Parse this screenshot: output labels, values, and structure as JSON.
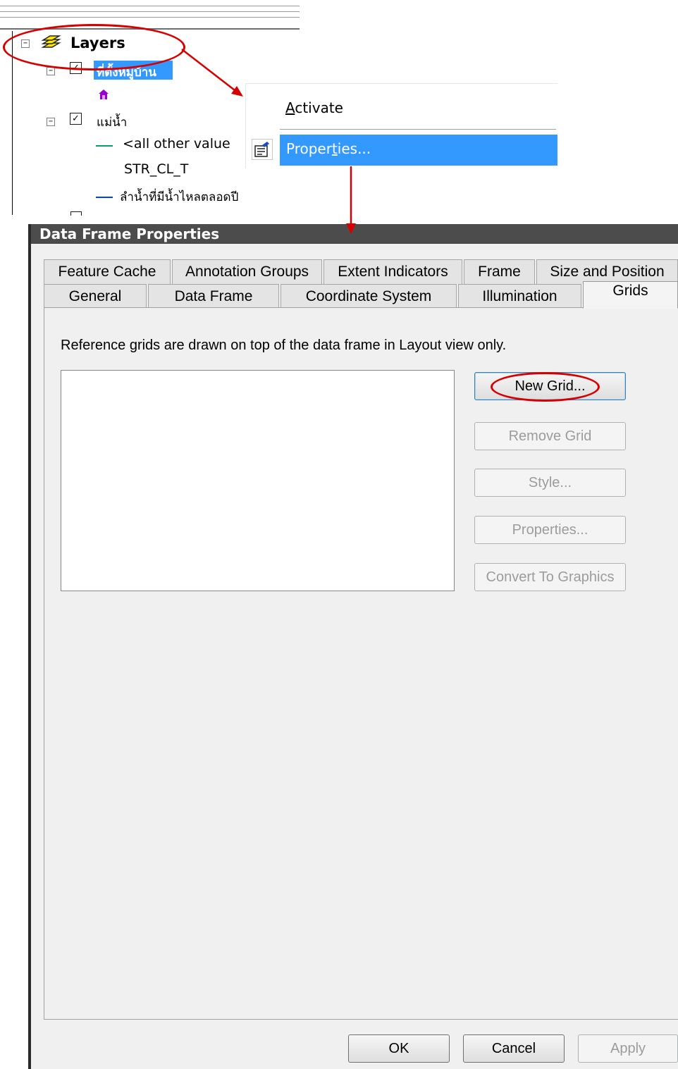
{
  "toc": {
    "root_label": "Layers",
    "layers": [
      {
        "label": "ที่ตั้งหมู่บ้าน",
        "checked": true,
        "selected": true,
        "symbol_color": "#9900cc"
      },
      {
        "label": "แม่น้ำ",
        "checked": true,
        "legend": [
          {
            "label": "<all other value",
            "color": "#00a06e"
          },
          {
            "label": "STR_CL_T"
          },
          {
            "label": "ลำน้ำที่มีน้ำไหลตลอดปี",
            "color": "#0040ff"
          }
        ]
      }
    ]
  },
  "context_menu": {
    "items": [
      {
        "label": "Activate",
        "mnemonic": "A",
        "rest": "ctivate"
      },
      {
        "label": "Properties...",
        "highlighted": true,
        "before": "Proper",
        "mnemonic": "t",
        "after": "ies...",
        "icon": "properties-icon"
      }
    ]
  },
  "dialog": {
    "title": "Data Frame Properties",
    "tabs_row1": [
      "Feature Cache",
      "Annotation Groups",
      "Extent Indicators",
      "Frame",
      "Size and Position"
    ],
    "tabs_row2": [
      "General",
      "Data Frame",
      "Coordinate System",
      "Illumination",
      "Grids"
    ],
    "active_tab": "Grids",
    "grids_page": {
      "description": "Reference grids are drawn on top of the data frame in Layout view only.",
      "buttons": {
        "new_grid": "New Grid...",
        "remove_grid": "Remove Grid",
        "style": "Style...",
        "properties": "Properties...",
        "convert": "Convert To Graphics"
      }
    },
    "footer": {
      "ok": "OK",
      "cancel": "Cancel",
      "apply": "Apply"
    }
  },
  "annotation_color": "#d60000",
  "highlight_color": "#3399ff"
}
